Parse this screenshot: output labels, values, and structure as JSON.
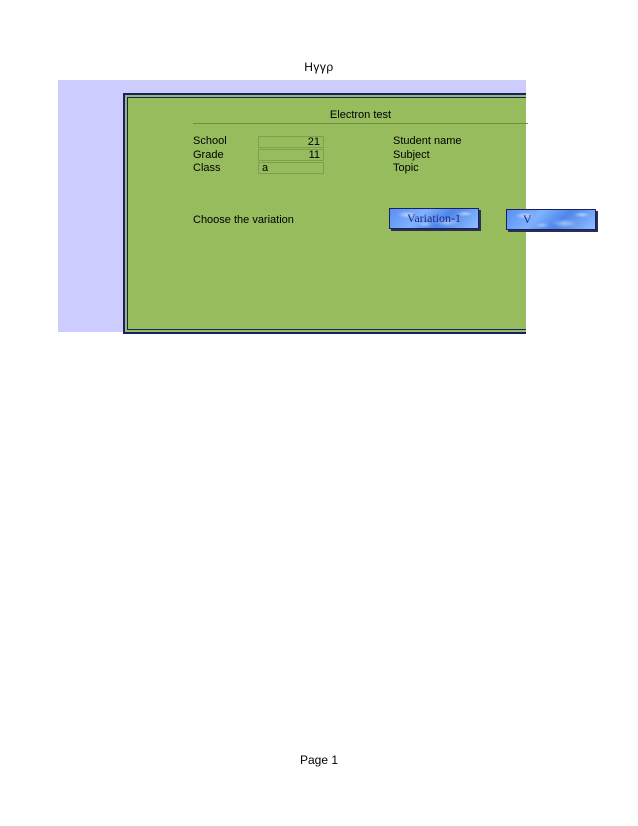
{
  "header": {
    "text": "Hγγρ"
  },
  "footer": {
    "text": "Page 1"
  },
  "panel": {
    "title": "Electron test",
    "fields_left": [
      {
        "label": "School",
        "value": "21",
        "align": "num"
      },
      {
        "label": "Grade",
        "value": "11",
        "align": "num"
      },
      {
        "label": "Class",
        "value": "a",
        "align": "txt"
      }
    ],
    "fields_right": [
      {
        "label": "Student name"
      },
      {
        "label": "Subject"
      },
      {
        "label": "Topic"
      }
    ],
    "choose_label": "Choose the variation",
    "buttons": [
      {
        "label": "Variation-1"
      },
      {
        "label": "V"
      }
    ]
  },
  "colors": {
    "sheet_background": "#ccccff",
    "panel_background": "#96bc5e",
    "border_dark_blue": "#1a1f6b",
    "button_blue": "#5a8ff0"
  }
}
